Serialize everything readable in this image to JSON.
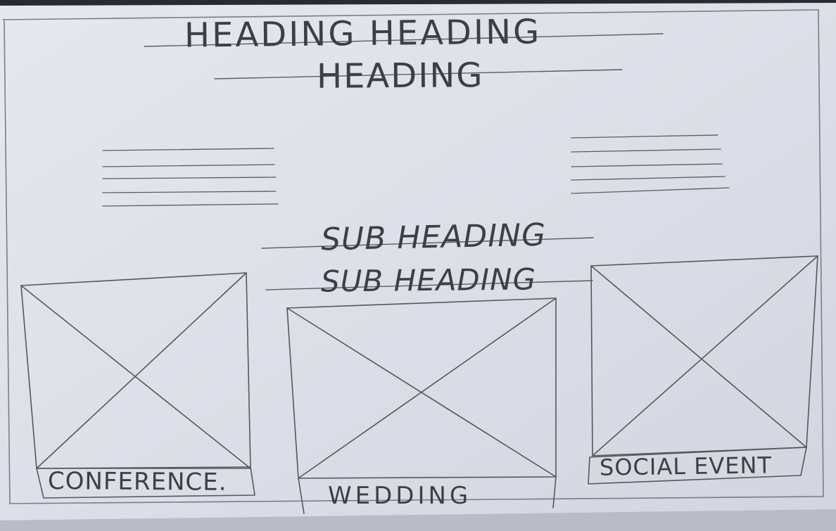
{
  "sketch": {
    "heading_line_1": "HEADING HEADING",
    "heading_line_2": "HEADING",
    "subheading_line_1": "SUB HEADING",
    "subheading_line_2": "SUB HEADING",
    "cards": [
      {
        "caption": "CONFERENCE."
      },
      {
        "caption": "WEDDING"
      },
      {
        "caption": "SOCIAL EVENT"
      }
    ]
  },
  "colors": {
    "paper": "#dde0e8",
    "pencil": "#4a4c54",
    "pencil_light": "#7b7e88",
    "background": "#1c1d22"
  }
}
